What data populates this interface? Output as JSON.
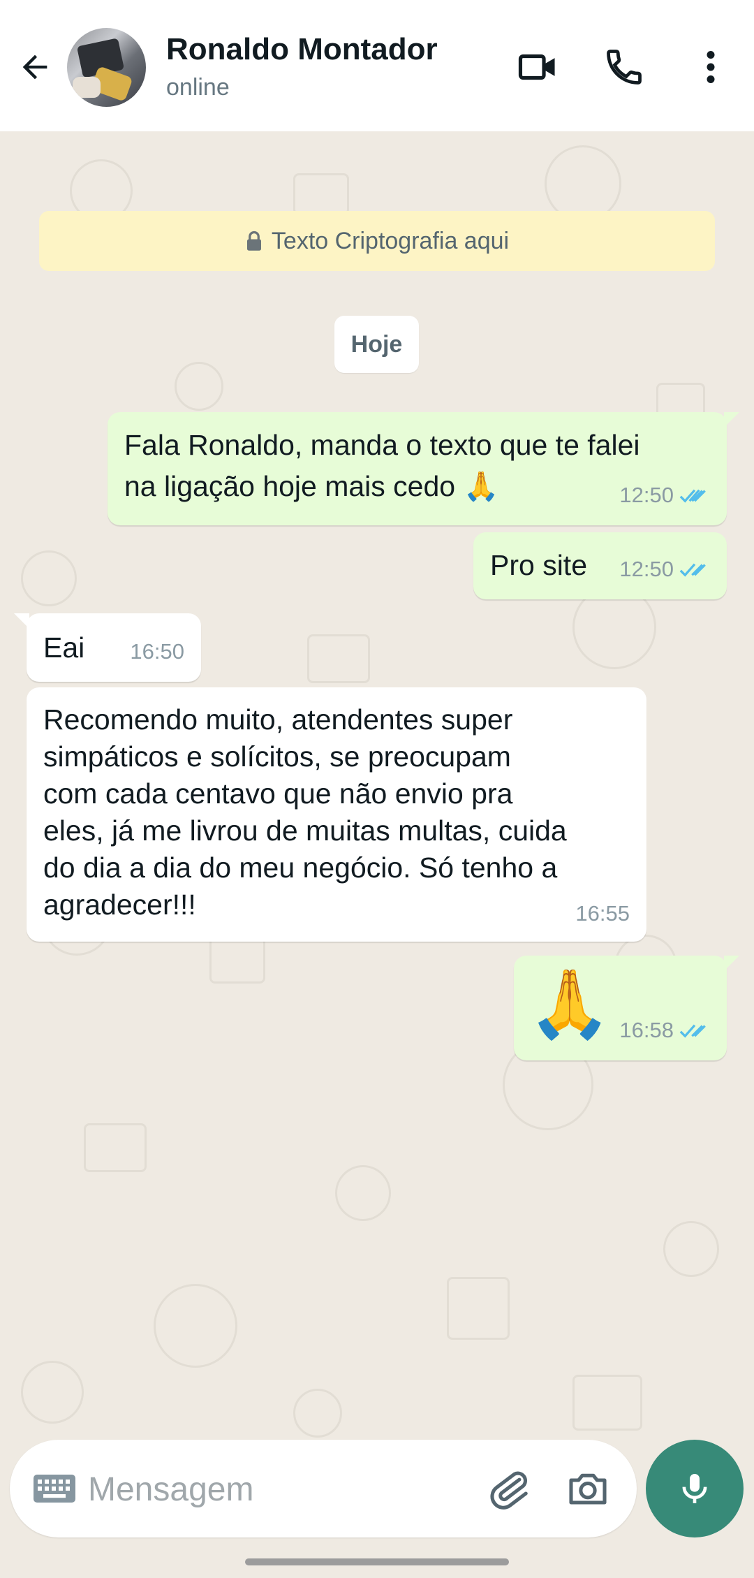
{
  "header": {
    "contact_name": "Ronaldo Montador",
    "status": "online",
    "back_icon": "arrow-back-icon",
    "video_icon": "video-call-icon",
    "call_icon": "phone-icon",
    "menu_icon": "more-vertical-icon"
  },
  "encryption_banner": {
    "icon": "lock-icon",
    "text": "Texto Criptografia aqui"
  },
  "date_chip": "Hoje",
  "messages": [
    {
      "direction": "out",
      "lines": [
        "Fala Ronaldo, manda o texto que te falei",
        "na ligação hoje mais cedo 🙏"
      ],
      "time": "12:50",
      "status": "read"
    },
    {
      "direction": "out",
      "lines": [
        "Pro site"
      ],
      "time": "12:50",
      "status": "read"
    },
    {
      "direction": "in",
      "lines": [
        "Eai"
      ],
      "time": "16:50"
    },
    {
      "direction": "in",
      "lines": [
        "Recomendo muito, atendentes super",
        "simpáticos e solícitos, se preocupam",
        "com cada centavo que não envio pra",
        "eles, já me livrou de muitas multas, cuida",
        "do dia a dia do meu negócio. Só tenho a",
        "agradecer!!!"
      ],
      "time": "16:55"
    },
    {
      "direction": "out",
      "lines": [
        "🙏"
      ],
      "time": "16:58",
      "status": "read"
    }
  ],
  "composer": {
    "placeholder": "Mensagem",
    "keyboard_icon": "keyboard-icon",
    "attach_icon": "paperclip-icon",
    "camera_icon": "camera-icon",
    "mic_icon": "microphone-icon"
  },
  "colors": {
    "wallpaper": "#efeae2",
    "outgoing_bubble": "#e7fcd7",
    "incoming_bubble": "#ffffff",
    "read_ticks": "#53bdeb",
    "accent": "#378a78",
    "banner": "#fdf4c5"
  }
}
